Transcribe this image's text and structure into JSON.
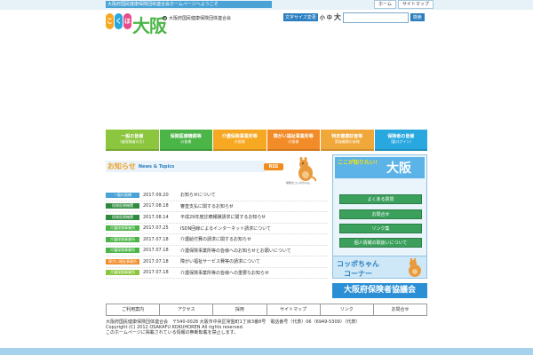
{
  "header": {
    "tagline": "大阪府国民健康保険団体連合会ホームページへようこそ",
    "top_links": [
      "ホーム",
      "サイトマップ"
    ],
    "logo_chars": [
      "こ",
      "く",
      "ほ"
    ],
    "logo_text": "大阪",
    "org_name": "大阪府国民健康保険団体連合会",
    "font_size_label": "文字サイズ変更",
    "font_sizes": [
      "小",
      "中",
      "大"
    ],
    "search_placeholder": "",
    "search_button": "検索"
  },
  "nav": [
    {
      "label": "一般の皆様",
      "sub": "（被保険者の方）",
      "color": "#8cc63f"
    },
    {
      "label": "保険医療機関等",
      "sub": "の皆様",
      "color": "#4cb548"
    },
    {
      "label": "介護保険事業所等",
      "sub": "の皆様",
      "color": "#f7a823"
    },
    {
      "label": "障がい福祉事業所等",
      "sub": "の皆様",
      "color": "#f28c28"
    },
    {
      "label": "特定健康診査等",
      "sub": "実施機関の皆様",
      "color": "#f0a83a"
    },
    {
      "label": "保険者の皆様",
      "sub": "（要ログイン）",
      "color": "#29a8df"
    }
  ],
  "news": {
    "title_jp": "お知らせ",
    "title_en": "News & Topics",
    "rss": "RSS",
    "mascot_caption": "場所のコッポちゃん",
    "items": [
      {
        "badge": "一般の皆様",
        "badge_color": "#4aa3d4",
        "date": "2017.09.20",
        "title": "お知らせについて"
      },
      {
        "badge": "保険医療機関",
        "badge_color": "#2e8b3e",
        "date": "2017.08.18",
        "title": "審査支払に関するお知らせ"
      },
      {
        "badge": "保険医療機関",
        "badge_color": "#2e8b3e",
        "date": "2017.08.14",
        "title": "平成29年度診療報酬請求に関するお知らせ"
      },
      {
        "badge": "介護保険事業所",
        "badge_color": "#4cb548",
        "date": "2017.07.25",
        "title": "ISDN回線によるインターネット請求について"
      },
      {
        "badge": "介護保険事業所",
        "badge_color": "#4cb548",
        "date": "2017.07.18",
        "title": "介護給付費の請求に関するお知らせ"
      },
      {
        "badge": "介護保険事業所",
        "badge_color": "#4cb548",
        "date": "2017.07.18",
        "title": "介護保険事業所等の皆様へのお知らせとお願いについて"
      },
      {
        "badge": "障がい福祉事業所",
        "badge_color": "#f28c28",
        "date": "2017.07.18",
        "title": "障がい福祉サービス費等の請求について"
      },
      {
        "badge": "介護保険事業所",
        "badge_color": "#8cc63f",
        "date": "2017.07.18",
        "title": "介護保険事業所等の皆様への重要なお知らせ"
      }
    ]
  },
  "sidebar": {
    "head_a": "ここが知りたい！",
    "head_b": "大阪",
    "buttons": [
      "よくある質問",
      "お問合せ",
      "リンク集",
      "個人情報の取扱いについて"
    ],
    "kopo_line1": "コッポちゃん",
    "kopo_line2": "コーナー",
    "association": "大阪府保険者協議会"
  },
  "footer": {
    "links": [
      "ご利用案内",
      "アクセス",
      "採用",
      "サイトマップ",
      "リンク",
      "お問合せ"
    ],
    "address": "大阪府国民健康保険団体連合会　〒540-0028 大阪市中央区常盤町1丁目3番8号　電話番号（代表）06（6949-5309）（代表）",
    "copyright": "Copyright (C) 2012 OSAKAFU KOKUHOREN All rights reserved.",
    "note": "このホームページに掲載されている情報の無断転載を禁止します。"
  },
  "colors": {
    "accent": "#2b7fc0",
    "brand_green": "#4cb548"
  }
}
